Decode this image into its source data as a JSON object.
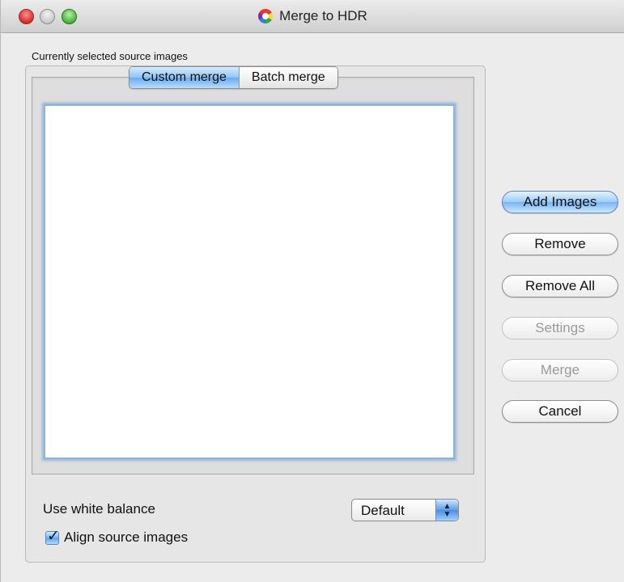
{
  "window": {
    "title": "Merge to HDR",
    "icon": "color-wheel-icon"
  },
  "source": {
    "label": "Currently selected source images",
    "tabs": [
      {
        "label": "Custom merge",
        "selected": true
      },
      {
        "label": "Batch merge",
        "selected": false
      }
    ],
    "items": []
  },
  "options": {
    "white_balance_label": "Use white balance",
    "white_balance_value": "Default",
    "align_label": "Align source images",
    "align_checked": true
  },
  "buttons": {
    "add_images": "Add Images",
    "remove": "Remove",
    "remove_all": "Remove All",
    "settings": "Settings",
    "merge": "Merge",
    "cancel": "Cancel"
  },
  "colors": {
    "accent": "#77b4f1",
    "close": "#d62b2b",
    "zoom": "#49b33a"
  }
}
